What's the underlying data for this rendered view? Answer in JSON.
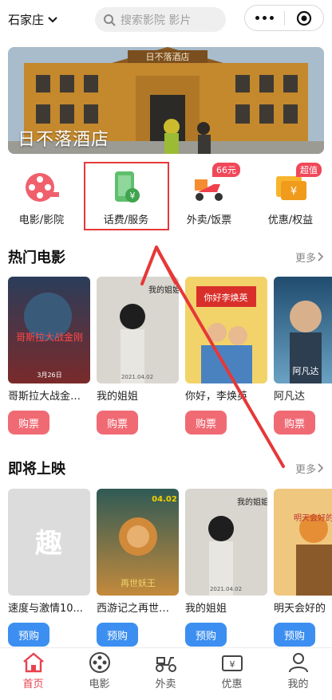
{
  "topbar": {
    "city": "石家庄",
    "search_placeholder": "搜索影院 影片"
  },
  "banner": {
    "title": "日不落酒店",
    "sign": "日不落酒店"
  },
  "categories": [
    {
      "label": "电影/影院",
      "icon": "film-reel-icon",
      "badge": ""
    },
    {
      "label": "话费/服务",
      "icon": "phone-recharge-icon",
      "badge": ""
    },
    {
      "label": "外卖/饭票",
      "icon": "scooter-icon",
      "badge": "66元"
    },
    {
      "label": "优惠/权益",
      "icon": "coupon-icon",
      "badge": "超值"
    }
  ],
  "hot": {
    "title": "热门电影",
    "more": "更多",
    "movies": [
      {
        "title": "哥斯拉大战金刚...",
        "button": "购票",
        "poster_text": "哥斯拉大战金刚",
        "poster_date": "3月26日"
      },
      {
        "title": "我的姐姐",
        "button": "购票",
        "poster_text": "我的姐姐",
        "poster_date": "2021.04.02"
      },
      {
        "title": "你好，李焕英",
        "button": "购票",
        "poster_text": "你好李焕英",
        "poster_date": ""
      },
      {
        "title": "阿凡达",
        "button": "购票",
        "poster_text": "阿凡达",
        "poster_date": ""
      }
    ]
  },
  "upcoming": {
    "title": "即将上映",
    "more": "更多",
    "movies": [
      {
        "title": "速度与激情10...",
        "button": "预购",
        "poster_text": "趣"
      },
      {
        "title": "西游记之再世妖...",
        "button": "预购",
        "poster_text": "再世妖王",
        "poster_date": "04.02"
      },
      {
        "title": "我的姐姐",
        "button": "预购",
        "poster_text": "我的姐姐",
        "poster_date": "2021.04.02"
      },
      {
        "title": "明天会好的",
        "button": "预购",
        "poster_text": "明天会好的"
      }
    ]
  },
  "tabs": [
    {
      "label": "首页",
      "icon": "home-icon",
      "active": true
    },
    {
      "label": "电影",
      "icon": "film-icon",
      "active": false
    },
    {
      "label": "外卖",
      "icon": "scooter-icon",
      "active": false
    },
    {
      "label": "优惠",
      "icon": "ticket-icon",
      "active": false
    },
    {
      "label": "我的",
      "icon": "user-icon",
      "active": false
    }
  ],
  "colors": {
    "accent_red": "#e8414e",
    "buy_button": "#f06a74",
    "presale_button": "#3c8ff0",
    "annotation_red": "#e63838"
  }
}
